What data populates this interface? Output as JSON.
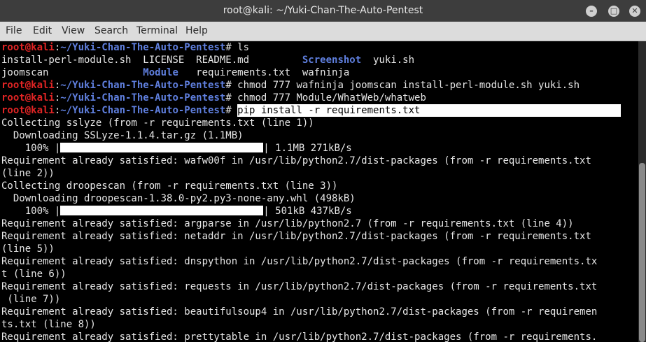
{
  "window": {
    "title": "root@kali: ~/Yuki-Chan-The-Auto-Pentest"
  },
  "controls": {
    "minimize": "–",
    "maximize": "□",
    "close": "✕"
  },
  "menu": [
    "File",
    "Edit",
    "View",
    "Search",
    "Terminal",
    "Help"
  ],
  "prompt": {
    "user": "root@kali",
    "sep": ":",
    "path": "~/Yuki-Chan-The-Auto-Pentest",
    "sym": "# "
  },
  "ls_rows": [
    [
      "install-perl-module.sh  LICENSE  README.md         ",
      "Screenshot",
      "  yuki.sh"
    ],
    [
      "joomscan                ",
      "Module",
      "   requirements.txt  wafninja"
    ]
  ],
  "commands": [
    "ls",
    "chmod 777 wafninja joomscan install-perl-module.sh yuki.sh",
    "chmod 777 Module/WhatWeb/whatweb",
    "pip install -r requirements.txt"
  ],
  "output": [
    "Collecting sslyze (from -r requirements.txt (line 1))",
    "  Downloading SSLyze-1.1.4.tar.gz (1.1MB)",
    "Requirement already satisfied: wafw00f in /usr/lib/python2.7/dist-packages (from -r requirements.txt",
    "(line 2))",
    "Collecting droopescan (from -r requirements.txt (line 3))",
    "  Downloading droopescan-1.38.0-py2.py3-none-any.whl (498kB)",
    "Requirement already satisfied: argparse in /usr/lib/python2.7 (from -r requirements.txt (line 4))",
    "Requirement already satisfied: netaddr in /usr/lib/python2.7/dist-packages (from -r requirements.txt",
    "(line 5))",
    "Requirement already satisfied: dnspython in /usr/lib/python2.7/dist-packages (from -r requirements.tx",
    "t (line 6))",
    "Requirement already satisfied: requests in /usr/lib/python2.7/dist-packages (from -r requirements.txt",
    " (line 7))",
    "Requirement already satisfied: beautifulsoup4 in /usr/lib/python2.7/dist-packages (from -r requiremen",
    "ts.txt (line 8))",
    "Requirement already satisfied: prettytable in /usr/lib/python2.7/dist-packages (from -r requirements."
  ],
  "progress": [
    {
      "pct_label": "    100% |",
      "fraction": 1.0,
      "tail": "| 1.1MB 271kB/s"
    },
    {
      "pct_label": "    100% |",
      "fraction": 1.0,
      "tail": "| 501kB 437kB/s"
    }
  ],
  "colors": {
    "user": "#e02424",
    "path": "#5f7fde",
    "dir": "#5f7fde",
    "text": "#e6e6e6",
    "bg": "#000000"
  }
}
